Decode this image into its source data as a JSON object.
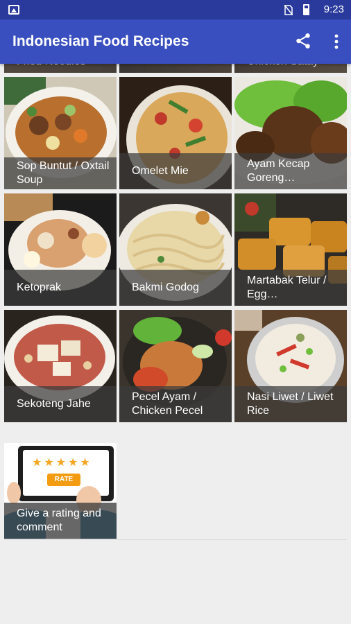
{
  "status_bar": {
    "time": "9:23"
  },
  "app_bar": {
    "title": "Indonesian Food Recipes"
  },
  "partial_row": [
    "Fried Noodles",
    "",
    "Chicken Satay"
  ],
  "recipes": [
    {
      "label": "Sop Buntut / Oxtail Soup"
    },
    {
      "label": "Omelet Mie"
    },
    {
      "label": "Ayam Kecap Goreng…"
    },
    {
      "label": "Ketoprak"
    },
    {
      "label": "Bakmi Godog"
    },
    {
      "label": "Martabak Telur / Egg…"
    },
    {
      "label": "Sekoteng Jahe"
    },
    {
      "label": "Pecel Ayam / Chicken Pecel"
    },
    {
      "label": "Nasi Liwet / Liwet Rice"
    }
  ],
  "rating": {
    "label": "Give a rating and comment",
    "button_text": "RATE",
    "stars": 5
  },
  "colors": {
    "status_bar": "#293a9c",
    "app_bar": "#3a4fbf",
    "star": "#f5a623",
    "rate_button": "#f39c12"
  }
}
